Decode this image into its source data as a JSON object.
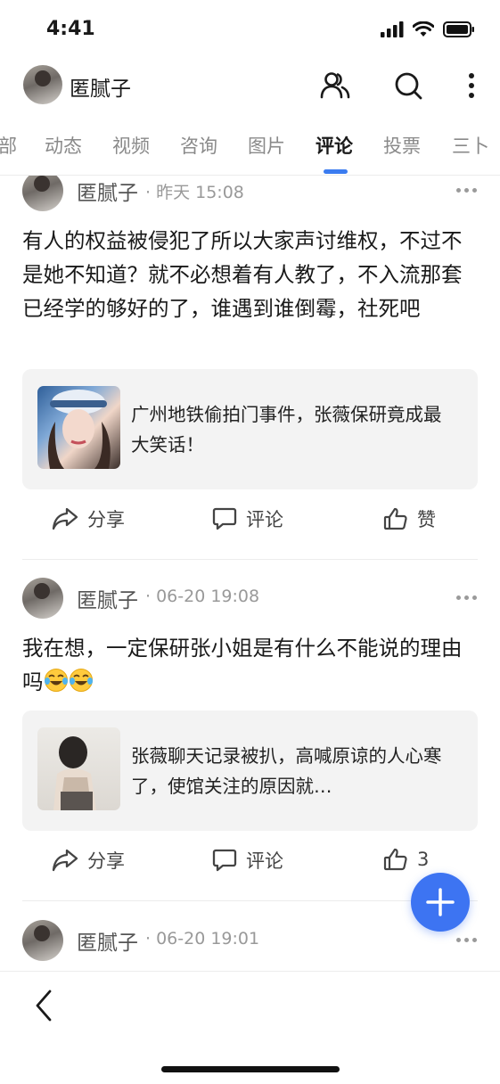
{
  "status_bar": {
    "time": "4:41"
  },
  "header": {
    "user_name": "匿腻子"
  },
  "tabs": [
    {
      "label": "部"
    },
    {
      "label": "动态"
    },
    {
      "label": "视频"
    },
    {
      "label": "咨询"
    },
    {
      "label": "图片"
    },
    {
      "label": "评论",
      "active": true
    },
    {
      "label": "投票"
    },
    {
      "label": "三卜"
    }
  ],
  "posts": [
    {
      "author": "匿腻子",
      "meta": "· 昨天 15:08",
      "text": "有人的权益被侵犯了所以大家声讨维权，不过不是她不知道？就不必想着有人教了，不入流那套已经学的够好的了，谁遇到谁倒霉，社死吧",
      "card_title": "广州地铁偷拍门事件，张薇保研竟成最大笑话！",
      "actions": {
        "share": "分享",
        "comment": "评论",
        "like": "赞"
      }
    },
    {
      "author": "匿腻子",
      "meta": "· 06-20 19:08",
      "text": "我在想，一定保研张小姐是有什么不能说的理由吗",
      "emojis": [
        "laughing-crying-emoji",
        "laughing-crying-emoji"
      ],
      "card_title": "张薇聊天记录被扒，高喊原谅的人心寒了，使馆关注的原因就…",
      "actions": {
        "share": "分享",
        "comment": "评论",
        "like": "3"
      }
    },
    {
      "author": "匿腻子",
      "meta": "· 06-20 19:01"
    }
  ],
  "colors": {
    "accent": "#3d74f2",
    "tab_indicator": "#3b7cf0",
    "card_bg": "#f3f3f3"
  }
}
